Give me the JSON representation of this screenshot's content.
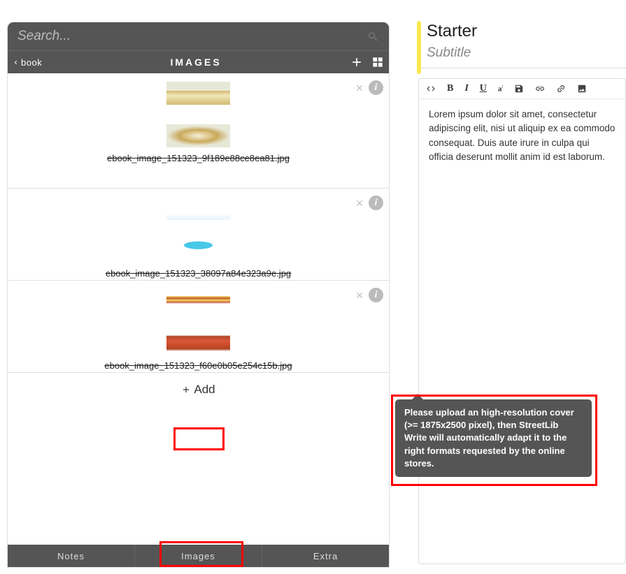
{
  "search": {
    "placeholder": "Search..."
  },
  "header": {
    "back_label": "book",
    "title": "IMAGES"
  },
  "images": [
    {
      "caption": "ebook_image_151323_9f189e88ce8ea81.jpg"
    },
    {
      "caption": "ebook_image_151323_38097a84e323a9e.jpg"
    },
    {
      "caption": "ebook_image_151323_f60e0b05e254c15b.jpg"
    }
  ],
  "add_button": {
    "label": "Add"
  },
  "bottom_tabs": [
    "Notes",
    "Images",
    "Extra"
  ],
  "document": {
    "title": "Starter",
    "subtitle": "Subtitle",
    "body": "Lorem ipsum dolor sit amet, consectetur adipiscing elit, nisi ut aliquip ex ea commodo consequat. Duis aute irure in culpa qui officia deserunt mollit anim id est laborum."
  },
  "tooltip": "Please upload an high-resolution cover (>= 1875x2500 pixel), then StreetLib Write will automatically adapt it to the right formats requested by the online stores."
}
